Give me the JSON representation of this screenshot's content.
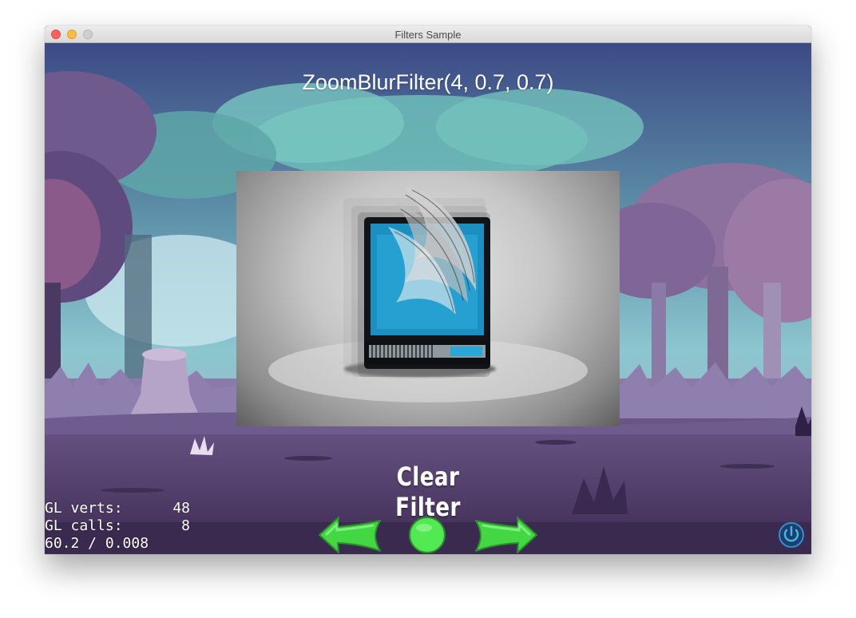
{
  "window": {
    "title": "Filters Sample"
  },
  "filter": {
    "title": "ZoomBlurFilter(4, 0.7, 0.7)"
  },
  "controls": {
    "clear_label": "Clear Filter",
    "prev_icon": "left-arrow-icon",
    "center_icon": "circle-icon",
    "next_icon": "right-arrow-icon",
    "power_icon": "power-icon"
  },
  "stats": {
    "verts_label": "GL verts:",
    "verts_value": "48",
    "calls_label": "GL calls:",
    "calls_value": "8",
    "fps": "60.2 / 0.008"
  },
  "colors": {
    "accent_green": "#5cf05c",
    "sky": "#6fb7b4",
    "ground": "#4f3a66"
  }
}
